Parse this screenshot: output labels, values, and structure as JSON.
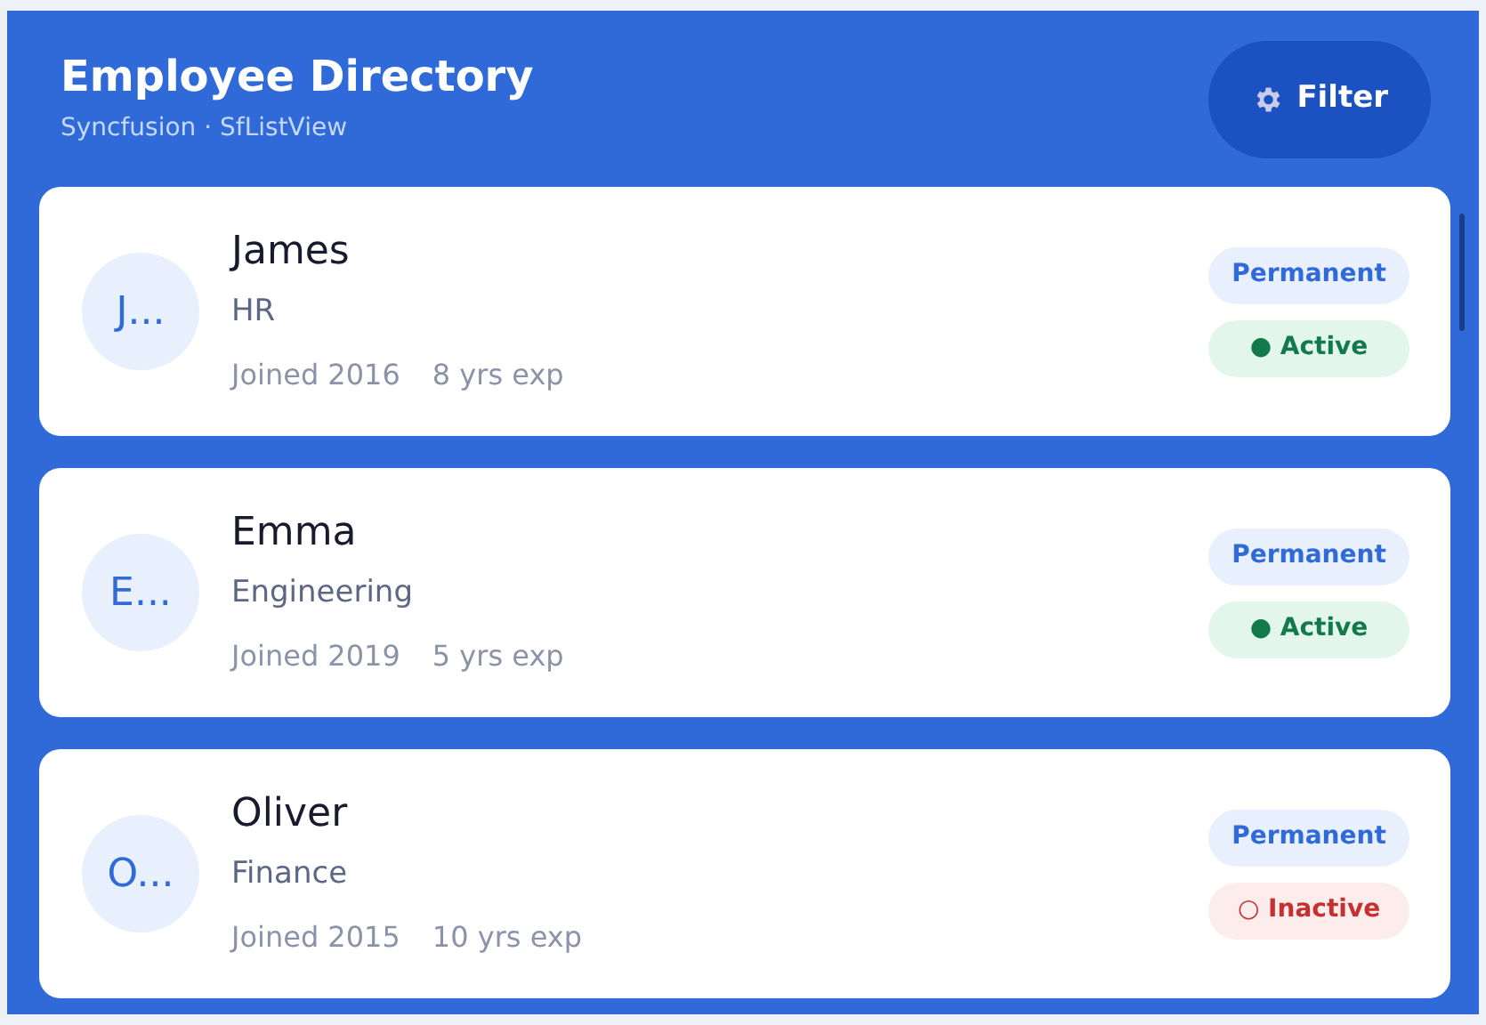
{
  "header": {
    "title": "Employee Directory",
    "subtitle": "Syncfusion · SfListView",
    "filter_button": "Filter"
  },
  "employees": [
    {
      "avatar": "J...",
      "name": "James",
      "department": "HR",
      "joined": "Joined 2016",
      "experience": "8 yrs exp",
      "type_badge": "Permanent",
      "status": {
        "kind": "active",
        "text": "● Active"
      }
    },
    {
      "avatar": "E...",
      "name": "Emma",
      "department": "Engineering",
      "joined": "Joined 2019",
      "experience": "5 yrs exp",
      "type_badge": "Permanent",
      "status": {
        "kind": "active",
        "text": "● Active"
      }
    },
    {
      "avatar": "O...",
      "name": "Oliver",
      "department": "Finance",
      "joined": "Joined 2015",
      "experience": "10 yrs exp",
      "type_badge": "Permanent",
      "status": {
        "kind": "inactive",
        "text": "○ Inactive"
      }
    }
  ]
}
